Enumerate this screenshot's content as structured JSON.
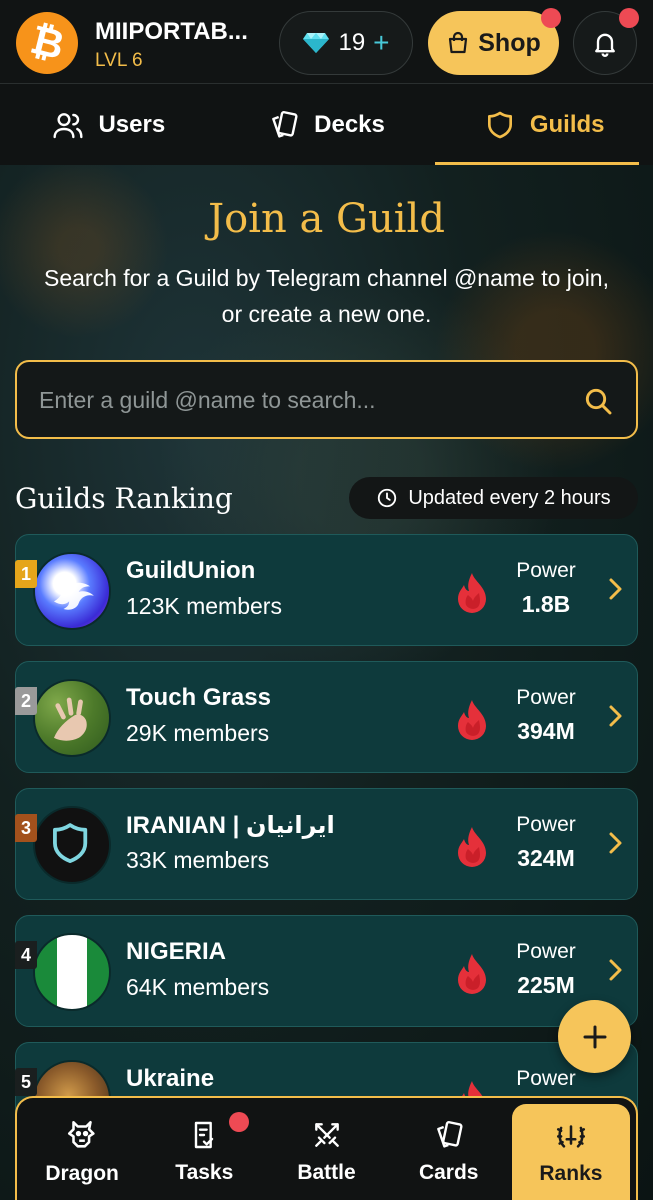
{
  "header": {
    "avatar_glyph": "₿",
    "username": "MIIPORTAB...",
    "level": "LVL 6",
    "gems": "19",
    "gems_plus": "+",
    "shop_label": "Shop",
    "colors": {
      "accent": "#f3bd4a",
      "notification": "#ee4a54",
      "avatar": "#f7931a"
    }
  },
  "tabs": [
    {
      "label": "Users",
      "icon": "users-icon",
      "active": false
    },
    {
      "label": "Decks",
      "icon": "cards-icon",
      "active": false
    },
    {
      "label": "Guilds",
      "icon": "shield-icon",
      "active": true
    }
  ],
  "hero": {
    "title": "Join a Guild",
    "subtitle": "Search for a Guild by Telegram channel @name to join, or create a new one."
  },
  "search": {
    "placeholder": "Enter a guild @name to search...",
    "value": ""
  },
  "ranking": {
    "title": "Guilds Ranking",
    "updated": "Updated every 2 hours",
    "power_label": "Power",
    "guilds": [
      {
        "rank": "1",
        "name": "GuildUnion",
        "members": "123K members",
        "power": "1.8B",
        "logo": "dragon-logo"
      },
      {
        "rank": "2",
        "name": "Touch Grass",
        "members": "29K members",
        "power": "394M",
        "logo": "hand-on-grass-photo"
      },
      {
        "rank": "3",
        "name": "IRANIAN | ایرانیان",
        "members": "33K members",
        "power": "324M",
        "logo": "shield-logo"
      },
      {
        "rank": "4",
        "name": "NIGERIA",
        "members": "64K members",
        "power": "225M",
        "logo": "nigeria-flag"
      },
      {
        "rank": "5",
        "name": "Ukraine",
        "members": "",
        "power": "",
        "logo": "dragon-photo"
      }
    ]
  },
  "fab": {
    "label": "+"
  },
  "bottom_nav": [
    {
      "label": "Dragon",
      "icon": "dragon-icon",
      "active": false
    },
    {
      "label": "Tasks",
      "icon": "tasks-icon",
      "active": false,
      "badge": true
    },
    {
      "label": "Battle",
      "icon": "swords-icon",
      "active": false
    },
    {
      "label": "Cards",
      "icon": "cards-icon",
      "active": false
    },
    {
      "label": "Ranks",
      "icon": "laurel-icon",
      "active": true
    }
  ]
}
